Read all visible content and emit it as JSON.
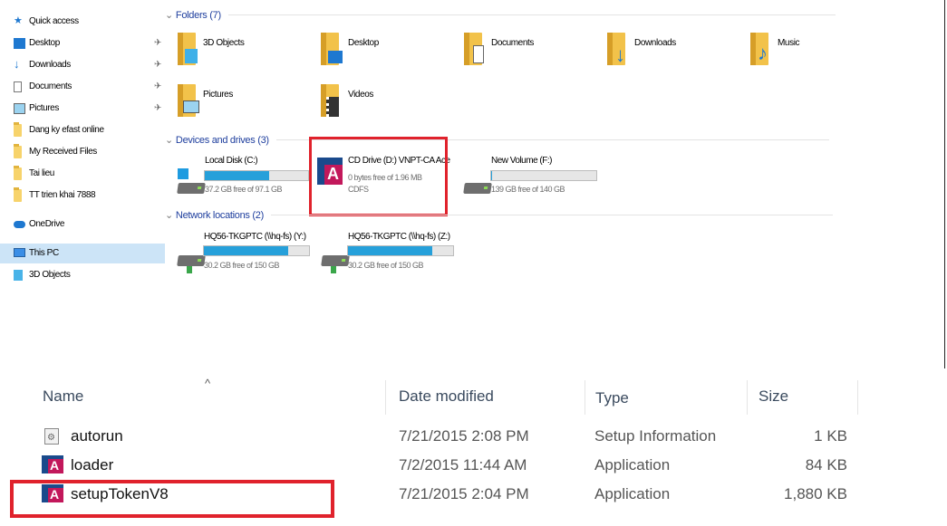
{
  "nav": {
    "quick_access": "Quick access",
    "pinned": [
      {
        "label": "Desktop",
        "icon": "desktop-icon"
      },
      {
        "label": "Downloads",
        "icon": "download-arrow-icon"
      },
      {
        "label": "Documents",
        "icon": "documents-icon"
      },
      {
        "label": "Pictures",
        "icon": "pictures-icon"
      }
    ],
    "folders": [
      "Dang ky efast online",
      "My Received Files",
      "Tai lieu",
      "TT trien khai 7888"
    ],
    "onedrive": "OneDrive",
    "this_pc": "This PC",
    "objects_3d": "3D Objects"
  },
  "groups": {
    "folders": "Folders (7)",
    "devices": "Devices and drives (3)",
    "network": "Network locations (2)"
  },
  "folders": [
    "3D Objects",
    "Desktop",
    "Documents",
    "Downloads",
    "Music",
    "Pictures",
    "Videos"
  ],
  "drives": [
    {
      "name": "Local Disk (C:)",
      "sub": "37.2 GB free of 97.1 GB",
      "used": 0.62
    },
    {
      "name": "CD Drive (D:) VNPT-CA Ace",
      "sub": "0 bytes free of 1.96 MB",
      "sub2": "CDFS"
    },
    {
      "name": "New Volume (F:)",
      "sub": "139 GB free of 140 GB",
      "used": 0.01
    }
  ],
  "network": [
    {
      "name": "HQ56-TKGPTC (\\\\hq-fs) (Y:)",
      "sub": "30.2 GB free of 150 GB",
      "used": 0.8
    },
    {
      "name": "HQ56-TKGPTC (\\\\hq-fs) (Z:)",
      "sub": "30.2 GB free of 150 GB",
      "used": 0.8
    }
  ],
  "columns": {
    "sort_indicator": "^",
    "name": "Name",
    "date": "Date modified",
    "type": "Type",
    "size": "Size"
  },
  "files": [
    {
      "name": "autorun",
      "date": "7/21/2015 2:08 PM",
      "type": "Setup Information",
      "size": "1 KB"
    },
    {
      "name": "loader",
      "date": "7/2/2015 11:44 AM",
      "type": "Application",
      "size": "84 KB"
    },
    {
      "name": "setupTokenV8",
      "date": "7/21/2015 2:04 PM",
      "type": "Application",
      "size": "1,880 KB"
    }
  ],
  "colors": {
    "accent": "#26a0da",
    "highlight": "#e0222c",
    "selection": "#cce4f7",
    "ca_blue": "#1a4a8c",
    "ca_magenta": "#c2185b"
  }
}
